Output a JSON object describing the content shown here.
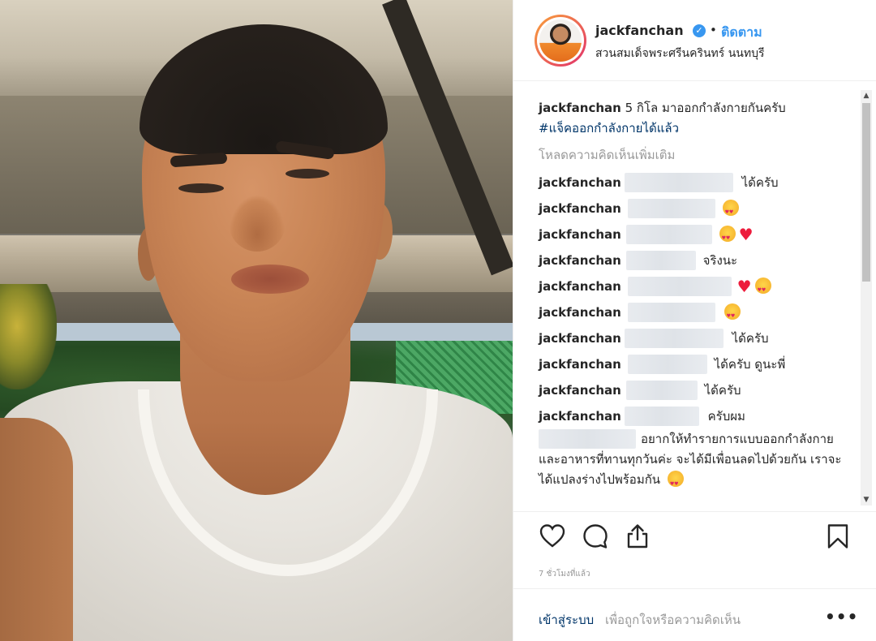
{
  "post": {
    "username": "jackfanchan",
    "verified_icon": "✓",
    "separator": "•",
    "follow_label": "ติดตาม",
    "location": "สวนสมเด็จพระศรีนครินทร์ นนทบุรี",
    "caption_user": "jackfanchan",
    "caption_text": " 5 กิโล มาออกกำลังกายกันครับ",
    "hashtag": "#แจ็คออกกำลังกายได้แล้ว",
    "load_more": "โหลดความคิดเห็นเพิ่มเติม",
    "time": "7 ชั่วโมงที่แล้ว"
  },
  "comments": [
    {
      "user": "jackfanchan",
      "text": "ได้ครับ",
      "extra": ""
    },
    {
      "user": "jackfanchan",
      "text": "",
      "extra": "star-eyes"
    },
    {
      "user": "jackfanchan",
      "text": "",
      "extra": "star-eyes heart"
    },
    {
      "user": "jackfanchan",
      "text": "จริงนะ",
      "extra": ""
    },
    {
      "user": "jackfanchan",
      "text": "",
      "extra": "heart star-eyes"
    },
    {
      "user": "jackfanchan",
      "text": "",
      "extra": "star-eyes"
    },
    {
      "user": "jackfanchan",
      "text": "ได้ครับ",
      "extra": ""
    },
    {
      "user": "jackfanchan",
      "text": "ได้ครับ ดูนะพี่",
      "extra": ""
    },
    {
      "user": "jackfanchan",
      "text": "ได้ครับ",
      "extra": ""
    },
    {
      "user": "jackfanchan",
      "text": "ครับผม",
      "extra": ""
    }
  ],
  "long_comment": {
    "text": "อยากให้ทำรายการแบบออกกำลังกาย และอาหารที่ทานทุกวันค่ะ จะได้มีเพื่อนลดไปด้วยกัน เราจะได้แปลงร่างไปพร้อมกัน"
  },
  "footer": {
    "login_link": "เข้าสู่ระบบ",
    "login_text": "เพื่อถูกใจหรือความคิดเห็น",
    "more": "•••"
  },
  "icons": {
    "like": "heart-icon",
    "comment": "comment-icon",
    "share": "share-icon",
    "save": "bookmark-icon"
  },
  "colors": {
    "link_blue": "#3897f0",
    "text": "#262626",
    "muted": "#999999",
    "heart_red": "#ed1c3c"
  }
}
